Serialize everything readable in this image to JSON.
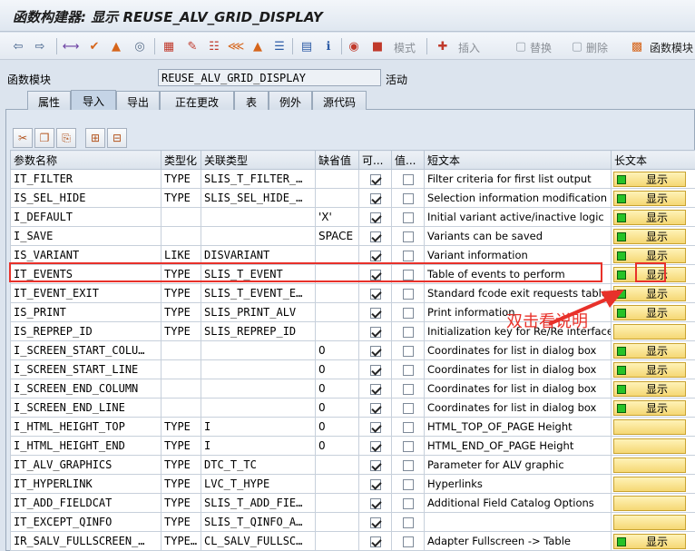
{
  "window": {
    "title": "函数构建器: 显示 REUSE_ALV_GRID_DISPLAY"
  },
  "toolbar": {
    "icons": [
      "back-arrow-icon",
      "forward-arrow-icon",
      "other-object-icon",
      "check-icon",
      "activate-icon",
      "where-used-icon",
      "display-object-list-icon",
      "edit-icon",
      "navigation-icon",
      "hierarchy-icon",
      "enhance-icon",
      "info-icon",
      "test-icon",
      "debug-icon",
      "pattern-icon",
      "insert-icon",
      "replace-icon",
      "delete-icon",
      "function-module-doc-icon"
    ],
    "labels": {
      "mode": "模式",
      "insert": "插入",
      "replace": "替换",
      "delete": "删除",
      "fm_doc": "函数模块"
    }
  },
  "header": {
    "label": "函数模块",
    "value": "REUSE_ALV_GRID_DISPLAY",
    "status": "活动"
  },
  "tabs": [
    {
      "label": "属性"
    },
    {
      "label": "导入"
    },
    {
      "label": "导出"
    },
    {
      "label": "正在更改"
    },
    {
      "label": "表"
    },
    {
      "label": "例外"
    },
    {
      "label": "源代码"
    }
  ],
  "active_tab": "导入",
  "grid_toolbar": [
    "cut-icon",
    "copy-icon",
    "paste-icon",
    "insert-row-icon",
    "delete-row-icon"
  ],
  "columns": [
    "参数名称",
    "类型化",
    "关联类型",
    "缺省值",
    "可...",
    "值...",
    "短文本",
    "长文本"
  ],
  "long_text_button": "显示",
  "rows": [
    {
      "name": "IT_FILTER",
      "typing": "TYPE",
      "ref": "SLIS_T_FILTER_…",
      "default": "",
      "optional": true,
      "value": false,
      "short": "Filter criteria for first list output",
      "has_doc": true
    },
    {
      "name": "IS_SEL_HIDE",
      "typing": "TYPE",
      "ref": "SLIS_SEL_HIDE_…",
      "default": "",
      "optional": true,
      "value": false,
      "short": "Selection information modification",
      "has_doc": true
    },
    {
      "name": "I_DEFAULT",
      "typing": "",
      "ref": "",
      "default": "'X'",
      "optional": true,
      "value": false,
      "short": "Initial variant active/inactive logic",
      "has_doc": true
    },
    {
      "name": "I_SAVE",
      "typing": "",
      "ref": "",
      "default": "SPACE",
      "optional": true,
      "value": false,
      "short": "Variants can be saved",
      "has_doc": true
    },
    {
      "name": "IS_VARIANT",
      "typing": "LIKE",
      "ref": "DISVARIANT",
      "default": "",
      "optional": true,
      "value": false,
      "short": "Variant information",
      "has_doc": true
    },
    {
      "name": "IT_EVENTS",
      "typing": "TYPE",
      "ref": "SLIS_T_EVENT",
      "default": "",
      "optional": true,
      "value": false,
      "short": "Table of events to perform",
      "has_doc": true
    },
    {
      "name": "IT_EVENT_EXIT",
      "typing": "TYPE",
      "ref": "SLIS_T_EVENT_E…",
      "default": "",
      "optional": true,
      "value": false,
      "short": "Standard fcode exit requests table",
      "has_doc": true
    },
    {
      "name": "IS_PRINT",
      "typing": "TYPE",
      "ref": "SLIS_PRINT_ALV",
      "default": "",
      "optional": true,
      "value": false,
      "short": "Print information",
      "has_doc": true
    },
    {
      "name": "IS_REPREP_ID",
      "typing": "TYPE",
      "ref": "SLIS_REPREP_ID",
      "default": "",
      "optional": true,
      "value": false,
      "short": "Initialization key for Re/Re interface",
      "has_doc": false
    },
    {
      "name": "I_SCREEN_START_COLU…",
      "typing": "",
      "ref": "",
      "default": "0",
      "optional": true,
      "value": false,
      "short": "Coordinates for list in dialog box",
      "has_doc": true
    },
    {
      "name": "I_SCREEN_START_LINE",
      "typing": "",
      "ref": "",
      "default": "0",
      "optional": true,
      "value": false,
      "short": "Coordinates for list in dialog box",
      "has_doc": true
    },
    {
      "name": "I_SCREEN_END_COLUMN",
      "typing": "",
      "ref": "",
      "default": "0",
      "optional": true,
      "value": false,
      "short": "Coordinates for list in dialog box",
      "has_doc": true
    },
    {
      "name": "I_SCREEN_END_LINE",
      "typing": "",
      "ref": "",
      "default": "0",
      "optional": true,
      "value": false,
      "short": "Coordinates for list in dialog box",
      "has_doc": true
    },
    {
      "name": "I_HTML_HEIGHT_TOP",
      "typing": "TYPE",
      "ref": "I",
      "default": "0",
      "optional": true,
      "value": false,
      "short": "HTML_TOP_OF_PAGE Height",
      "has_doc": false
    },
    {
      "name": "I_HTML_HEIGHT_END",
      "typing": "TYPE",
      "ref": "I",
      "default": "0",
      "optional": true,
      "value": false,
      "short": "HTML_END_OF_PAGE Height",
      "has_doc": false
    },
    {
      "name": "IT_ALV_GRAPHICS",
      "typing": "TYPE",
      "ref": "DTC_T_TC",
      "default": "",
      "optional": true,
      "value": false,
      "short": "Parameter for ALV graphic",
      "has_doc": false
    },
    {
      "name": "IT_HYPERLINK",
      "typing": "TYPE",
      "ref": "LVC_T_HYPE",
      "default": "",
      "optional": true,
      "value": false,
      "short": "Hyperlinks",
      "has_doc": false
    },
    {
      "name": "IT_ADD_FIELDCAT",
      "typing": "TYPE",
      "ref": "SLIS_T_ADD_FIE…",
      "default": "",
      "optional": true,
      "value": false,
      "short": "Additional Field Catalog Options",
      "has_doc": false
    },
    {
      "name": "IT_EXCEPT_QINFO",
      "typing": "TYPE",
      "ref": "SLIS_T_QINFO_A…",
      "default": "",
      "optional": true,
      "value": false,
      "short": "",
      "has_doc": false
    },
    {
      "name": "IR_SALV_FULLSCREEN_…",
      "typing": "TYPE…",
      "ref": "CL_SALV_FULLSC…",
      "default": "",
      "optional": true,
      "value": false,
      "short": "Adapter Fullscreen -> Table",
      "has_doc": true
    }
  ],
  "annotation": {
    "text": "双击看说明",
    "color": "#e8312a"
  },
  "colors": {
    "highlight": "#e8312a",
    "doc_indicator": "#27c227",
    "button_fill": "#f5d774"
  }
}
